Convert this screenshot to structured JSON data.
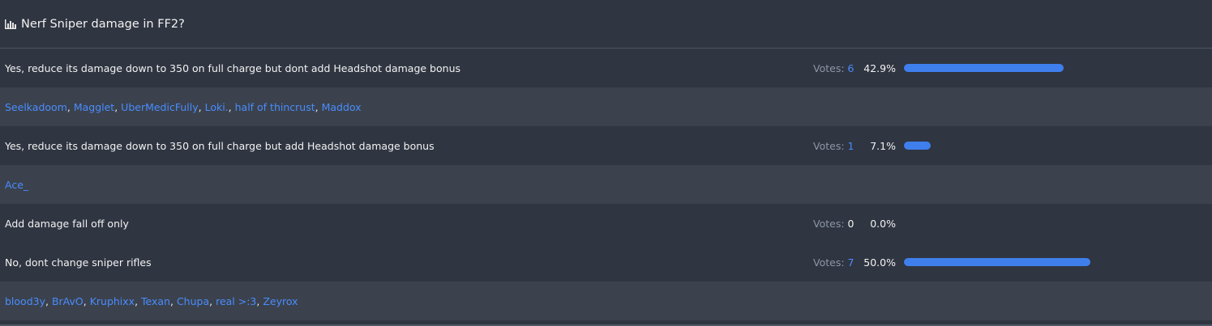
{
  "poll": {
    "title": "Nerf Sniper damage in FF2?",
    "accent_color": "#3f7fed",
    "link_color": "#4a8cff",
    "votes_label": "Votes:",
    "options": [
      {
        "text": "Yes, reduce its damage down to 350 on full charge but dont add Headshot damage bonus",
        "votes": "6",
        "percent": "42.9%",
        "fraction": 0.429,
        "voters": [
          "Seelkadoom",
          "Magglet",
          "UberMedicFully",
          "Loki.",
          "half of thincrust",
          "Maddox"
        ]
      },
      {
        "text": "Yes, reduce its damage down to 350 on full charge but add Headshot damage bonus",
        "votes": "1",
        "percent": "7.1%",
        "fraction": 0.071,
        "voters": [
          "Ace_"
        ]
      },
      {
        "text": "Add damage fall off only",
        "votes": "0",
        "percent": "0.0%",
        "fraction": 0.0,
        "voters": []
      },
      {
        "text": "No, dont change sniper rifles",
        "votes": "7",
        "percent": "50.0%",
        "fraction": 0.5,
        "voters": [
          "blood3y",
          "BrAvO",
          "Kruphixx",
          "Texan",
          "Chupa",
          "real >:3",
          "Zeyrox"
        ]
      }
    ]
  }
}
